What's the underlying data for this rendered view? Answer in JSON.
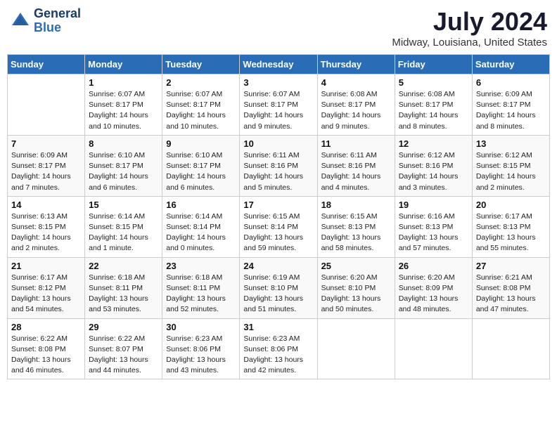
{
  "header": {
    "logo_line1": "General",
    "logo_line2": "Blue",
    "month_year": "July 2024",
    "location": "Midway, Louisiana, United States"
  },
  "weekdays": [
    "Sunday",
    "Monday",
    "Tuesday",
    "Wednesday",
    "Thursday",
    "Friday",
    "Saturday"
  ],
  "weeks": [
    [
      {
        "day": "",
        "info": ""
      },
      {
        "day": "1",
        "info": "Sunrise: 6:07 AM\nSunset: 8:17 PM\nDaylight: 14 hours\nand 10 minutes."
      },
      {
        "day": "2",
        "info": "Sunrise: 6:07 AM\nSunset: 8:17 PM\nDaylight: 14 hours\nand 10 minutes."
      },
      {
        "day": "3",
        "info": "Sunrise: 6:07 AM\nSunset: 8:17 PM\nDaylight: 14 hours\nand 9 minutes."
      },
      {
        "day": "4",
        "info": "Sunrise: 6:08 AM\nSunset: 8:17 PM\nDaylight: 14 hours\nand 9 minutes."
      },
      {
        "day": "5",
        "info": "Sunrise: 6:08 AM\nSunset: 8:17 PM\nDaylight: 14 hours\nand 8 minutes."
      },
      {
        "day": "6",
        "info": "Sunrise: 6:09 AM\nSunset: 8:17 PM\nDaylight: 14 hours\nand 8 minutes."
      }
    ],
    [
      {
        "day": "7",
        "info": "Sunrise: 6:09 AM\nSunset: 8:17 PM\nDaylight: 14 hours\nand 7 minutes."
      },
      {
        "day": "8",
        "info": "Sunrise: 6:10 AM\nSunset: 8:17 PM\nDaylight: 14 hours\nand 6 minutes."
      },
      {
        "day": "9",
        "info": "Sunrise: 6:10 AM\nSunset: 8:17 PM\nDaylight: 14 hours\nand 6 minutes."
      },
      {
        "day": "10",
        "info": "Sunrise: 6:11 AM\nSunset: 8:16 PM\nDaylight: 14 hours\nand 5 minutes."
      },
      {
        "day": "11",
        "info": "Sunrise: 6:11 AM\nSunset: 8:16 PM\nDaylight: 14 hours\nand 4 minutes."
      },
      {
        "day": "12",
        "info": "Sunrise: 6:12 AM\nSunset: 8:16 PM\nDaylight: 14 hours\nand 3 minutes."
      },
      {
        "day": "13",
        "info": "Sunrise: 6:12 AM\nSunset: 8:15 PM\nDaylight: 14 hours\nand 2 minutes."
      }
    ],
    [
      {
        "day": "14",
        "info": "Sunrise: 6:13 AM\nSunset: 8:15 PM\nDaylight: 14 hours\nand 2 minutes."
      },
      {
        "day": "15",
        "info": "Sunrise: 6:14 AM\nSunset: 8:15 PM\nDaylight: 14 hours\nand 1 minute."
      },
      {
        "day": "16",
        "info": "Sunrise: 6:14 AM\nSunset: 8:14 PM\nDaylight: 14 hours\nand 0 minutes."
      },
      {
        "day": "17",
        "info": "Sunrise: 6:15 AM\nSunset: 8:14 PM\nDaylight: 13 hours\nand 59 minutes."
      },
      {
        "day": "18",
        "info": "Sunrise: 6:15 AM\nSunset: 8:13 PM\nDaylight: 13 hours\nand 58 minutes."
      },
      {
        "day": "19",
        "info": "Sunrise: 6:16 AM\nSunset: 8:13 PM\nDaylight: 13 hours\nand 57 minutes."
      },
      {
        "day": "20",
        "info": "Sunrise: 6:17 AM\nSunset: 8:13 PM\nDaylight: 13 hours\nand 55 minutes."
      }
    ],
    [
      {
        "day": "21",
        "info": "Sunrise: 6:17 AM\nSunset: 8:12 PM\nDaylight: 13 hours\nand 54 minutes."
      },
      {
        "day": "22",
        "info": "Sunrise: 6:18 AM\nSunset: 8:11 PM\nDaylight: 13 hours\nand 53 minutes."
      },
      {
        "day": "23",
        "info": "Sunrise: 6:18 AM\nSunset: 8:11 PM\nDaylight: 13 hours\nand 52 minutes."
      },
      {
        "day": "24",
        "info": "Sunrise: 6:19 AM\nSunset: 8:10 PM\nDaylight: 13 hours\nand 51 minutes."
      },
      {
        "day": "25",
        "info": "Sunrise: 6:20 AM\nSunset: 8:10 PM\nDaylight: 13 hours\nand 50 minutes."
      },
      {
        "day": "26",
        "info": "Sunrise: 6:20 AM\nSunset: 8:09 PM\nDaylight: 13 hours\nand 48 minutes."
      },
      {
        "day": "27",
        "info": "Sunrise: 6:21 AM\nSunset: 8:08 PM\nDaylight: 13 hours\nand 47 minutes."
      }
    ],
    [
      {
        "day": "28",
        "info": "Sunrise: 6:22 AM\nSunset: 8:08 PM\nDaylight: 13 hours\nand 46 minutes."
      },
      {
        "day": "29",
        "info": "Sunrise: 6:22 AM\nSunset: 8:07 PM\nDaylight: 13 hours\nand 44 minutes."
      },
      {
        "day": "30",
        "info": "Sunrise: 6:23 AM\nSunset: 8:06 PM\nDaylight: 13 hours\nand 43 minutes."
      },
      {
        "day": "31",
        "info": "Sunrise: 6:23 AM\nSunset: 8:06 PM\nDaylight: 13 hours\nand 42 minutes."
      },
      {
        "day": "",
        "info": ""
      },
      {
        "day": "",
        "info": ""
      },
      {
        "day": "",
        "info": ""
      }
    ]
  ]
}
